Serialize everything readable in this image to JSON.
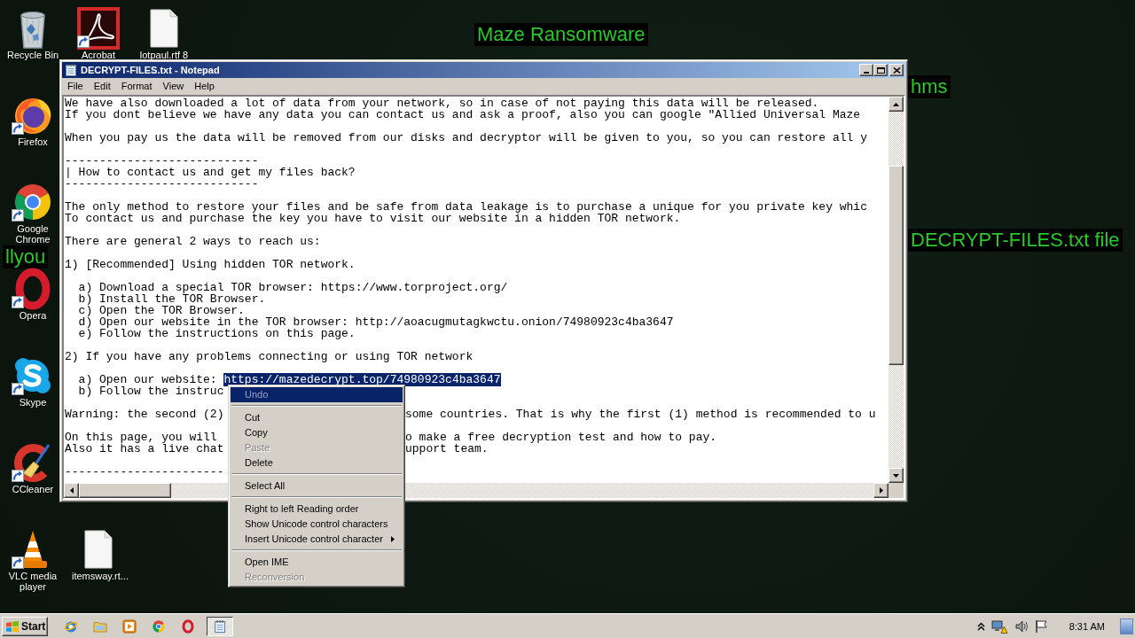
{
  "desktop": {
    "wallpaper_texts": [
      "Maze Ransomware",
      "hms",
      "llyou",
      "DECRYPT-FILES.txt file"
    ],
    "icons": [
      {
        "kind": "recycle-bin",
        "label": "Recycle Bin",
        "shortcut": false
      },
      {
        "kind": "acrobat",
        "label": "Acrobat",
        "shortcut": true
      },
      {
        "kind": "document",
        "label": "lotpaul.rtf 8",
        "shortcut": false
      },
      {
        "kind": "firefox",
        "label": "Firefox",
        "shortcut": true
      },
      {
        "kind": "chrome",
        "label": "Google Chrome",
        "shortcut": true
      },
      {
        "kind": "opera",
        "label": "Opera",
        "shortcut": true
      },
      {
        "kind": "skype",
        "label": "Skype",
        "shortcut": true
      },
      {
        "kind": "ccleaner",
        "label": "CCleaner",
        "shortcut": true
      },
      {
        "kind": "vlc",
        "label": "VLC media player",
        "shortcut": true
      },
      {
        "kind": "document",
        "label": "itemsway.rt...",
        "shortcut": false
      }
    ]
  },
  "window": {
    "title": "DECRYPT-FILES.txt - Notepad",
    "menu": [
      "File",
      "Edit",
      "Format",
      "View",
      "Help"
    ],
    "paragraphs": [
      [
        {
          "text": "We have also downloaded a lot of data from your network, so in case of not paying this data will be released."
        },
        {
          "text": "If you dont believe we have any data you can contact us and ask a proof, also you can google \"Allied Universal Maze"
        }
      ],
      [
        {
          "text": "When you pay us the data will be removed from our disks and decryptor will be given to you, so you can restore all y"
        }
      ],
      [
        {
          "text": "----------------------------"
        },
        {
          "text": "| How to contact us and get my files back?"
        },
        {
          "text": "----------------------------"
        }
      ],
      [
        {
          "text": "The only method to restore your files and be safe from data leakage is to purchase a unique for you private key whic"
        },
        {
          "text": "To contact us and purchase the key you have to visit our website in a hidden TOR network."
        }
      ],
      [
        {
          "text": "There are general 2 ways to reach us:"
        }
      ],
      [
        {
          "text": "1) [Recommended] Using hidden TOR network."
        }
      ],
      [
        {
          "text": "  a) Download a special TOR browser: https://www.torproject.org/"
        },
        {
          "text": "  b) Install the TOR Browser."
        },
        {
          "text": "  c) Open the TOR Browser."
        },
        {
          "text": "  d) Open our website in the TOR browser: http://aoacugmutagkwctu.onion/74980923c4ba3647"
        },
        {
          "text": "  e) Follow the instructions on this page."
        }
      ],
      [
        {
          "text": "2) If you have any problems connecting or using TOR network"
        }
      ],
      [
        {
          "text": "  a) Open our website: ",
          "selection": "https://mazedecrypt.top/74980923c4ba3647"
        },
        {
          "text": "  b) Follow the instruc"
        }
      ],
      [
        {
          "text": "Warning: the second (2)",
          "past_menu": "some countries. That is why the first (1) method is recommended to u"
        }
      ],
      [
        {
          "text": "On this page, you will",
          "past_menu": "o make a free decryption test and how to pay."
        },
        {
          "text": "Also it has a live chat",
          "past_menu": "upport team."
        }
      ],
      [
        {
          "text": "-----------------------"
        }
      ]
    ]
  },
  "context_menu": {
    "groups": [
      [
        {
          "label": "Undo",
          "disabled": true,
          "selected": true,
          "submenu": false
        }
      ],
      [
        {
          "label": "Cut",
          "disabled": false,
          "selected": false,
          "submenu": false
        },
        {
          "label": "Copy",
          "disabled": false,
          "selected": false,
          "submenu": false
        },
        {
          "label": "Paste",
          "disabled": true,
          "selected": false,
          "submenu": false
        },
        {
          "label": "Delete",
          "disabled": false,
          "selected": false,
          "submenu": false
        }
      ],
      [
        {
          "label": "Select All",
          "disabled": false,
          "selected": false,
          "submenu": false
        }
      ],
      [
        {
          "label": "Right to left Reading order",
          "disabled": false,
          "selected": false,
          "submenu": false
        },
        {
          "label": "Show Unicode control characters",
          "disabled": false,
          "selected": false,
          "submenu": false
        },
        {
          "label": "Insert Unicode control character",
          "disabled": false,
          "selected": false,
          "submenu": true
        }
      ],
      [
        {
          "label": "Open IME",
          "disabled": false,
          "selected": false,
          "submenu": false
        },
        {
          "label": "Reconversion",
          "disabled": true,
          "selected": false,
          "submenu": false
        }
      ]
    ]
  },
  "taskbar": {
    "start": "Start",
    "quick_launch": [
      {
        "kind": "ie"
      },
      {
        "kind": "folder"
      },
      {
        "kind": "media-player"
      },
      {
        "kind": "chrome"
      },
      {
        "kind": "opera"
      }
    ],
    "tasks": [
      {
        "kind": "notepad",
        "selected": true
      }
    ],
    "tray": [
      {
        "kind": "chevron"
      },
      {
        "kind": "network"
      },
      {
        "kind": "volume"
      },
      {
        "kind": "flag"
      }
    ],
    "clock": "8:31 AM"
  }
}
